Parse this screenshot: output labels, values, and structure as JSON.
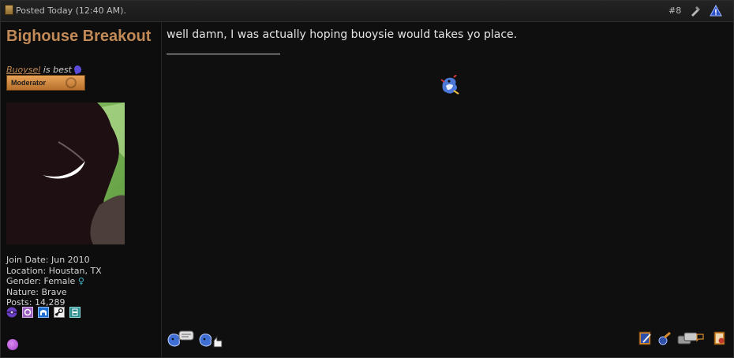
{
  "header": {
    "posted_text": "Posted Today (12:40 AM).",
    "post_number": "#8"
  },
  "user": {
    "username": "Bighouse Breakout",
    "title_link": "Buoysel",
    "title_rest": " is best",
    "rank": "Moderator",
    "info": {
      "join_date": "Join Date: Jun 2010",
      "location": "Location: Houstan, TX",
      "gender": "Gender: Female",
      "gender_symbol": "♀",
      "nature": "Nature: Brave",
      "posts": "Posts: 14,289"
    }
  },
  "post": {
    "message": "well damn, I was actually hoping buoysie would takes yo place."
  },
  "colors": {
    "username": "#c28a56",
    "rank_badge": "#d98b3c",
    "background": "#0f0f0f"
  },
  "icons": {
    "header": [
      "document-icon",
      "report-icon",
      "warning-icon"
    ],
    "badges": [
      "pokeball-purple-icon",
      "circle-badge-icon",
      "house-badge-icon",
      "steam-icon",
      "device-badge-icon"
    ],
    "footer_left": [
      "reputation-icon",
      "like-icon"
    ],
    "footer_right": [
      "edit-icon",
      "quote-icon",
      "multi-quote-icon",
      "reply-icon"
    ]
  }
}
